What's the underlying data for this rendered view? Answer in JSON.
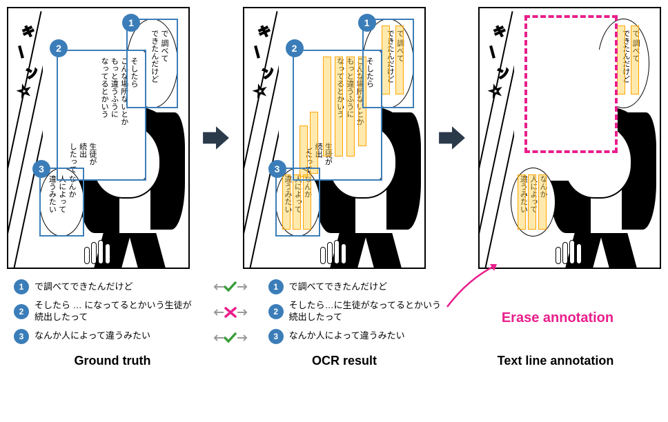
{
  "panels": {
    "ground_truth": {
      "label": "Ground truth",
      "badges": [
        "1",
        "2",
        "3"
      ],
      "bubble1_text": "で 調べて\nできたんだけど",
      "bubble2_text": "そしたら\nこんな場所ないとか\nもっと違うふうに\nなってるとかいう",
      "bubble2_text2": "生徒が\n続出\nしたって",
      "bubble3_text": "なんか\n人によって\n違うみたい"
    },
    "ocr_result": {
      "label": "OCR result",
      "badges": [
        "1",
        "2",
        "3"
      ]
    },
    "text_line": {
      "label": "Text line annotation"
    }
  },
  "comparison": {
    "left": [
      "で調べてできたんだけど",
      "そしたら … になってるとかいう生徒が続出したって",
      "なんか人によって違うみたい"
    ],
    "right": [
      "で調べてできたんだけど",
      "そしたら…に生徒がなってるとかいう続出したって",
      "なんか人によって違うみたい"
    ],
    "results": [
      "match",
      "mismatch",
      "match"
    ]
  },
  "erase_label": "Erase annotation"
}
